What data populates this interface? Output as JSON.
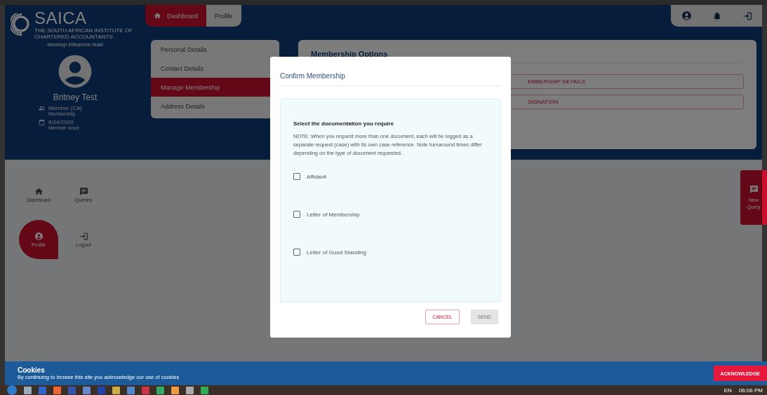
{
  "logo": {
    "name": "SAICA",
    "tagline": "THE SOUTH AFRICAN INSTITUTE OF CHARTERED ACCOUNTANTS",
    "motto": "develop.influence.lead"
  },
  "profile": {
    "name": "Britney Test",
    "details": [
      {
        "kind": "members",
        "value": "Member (CA)",
        "label": "Membership"
      },
      {
        "kind": "date",
        "value": "6/24/2020",
        "label": "Member since"
      }
    ]
  },
  "top_tabs": [
    {
      "kind": "home",
      "label": "Dashboard",
      "selected": true
    },
    {
      "kind": "plain",
      "label": "Profile",
      "selected": false
    }
  ],
  "top_icons": [
    {
      "kind": "account"
    },
    {
      "kind": "bell"
    },
    {
      "kind": "exit"
    }
  ],
  "profile_menu": [
    {
      "label": "Personal Details",
      "selected": false
    },
    {
      "label": "Contact Details",
      "selected": false
    },
    {
      "label": "Manage Membership",
      "selected": true
    },
    {
      "label": "Address Details",
      "selected": false
    }
  ],
  "membership_options": {
    "title": "Membership Options",
    "actions": [
      "EMBERSHIP DETAILS",
      "SIGNATION"
    ]
  },
  "side_nav": [
    {
      "kind": "home",
      "label": "Dashboard",
      "selected": false
    },
    {
      "kind": "queries",
      "label": "Queries",
      "selected": false
    },
    {
      "kind": "profile",
      "label": "Profile",
      "selected": true
    },
    {
      "kind": "exit",
      "label": "Logout",
      "selected": false
    }
  ],
  "new_query": {
    "label": "New Query"
  },
  "dialog": {
    "title": "Confirm Membership",
    "heading": "Select the documentation you require",
    "note": "NOTE: When you request more than one document, each will be logged as a separate request (case) with its own case reference. Note turnaround times differ depending on the type of document requested.",
    "options": [
      {
        "label": "Affidavit",
        "checked": false
      },
      {
        "label": "Letter of Membership",
        "checked": false
      },
      {
        "label": "Letter of Good Standing",
        "checked": false
      }
    ],
    "buttons": [
      {
        "kind": "cancel",
        "label": "CANCEL",
        "disabled": false
      },
      {
        "kind": "send",
        "label": "SEND",
        "disabled": true
      }
    ]
  },
  "cookie_bar": {
    "title": "Cookies",
    "text": "By continuing to browse this site you acknowledge our use of cookies",
    "button": "ACKNOWLEDGE"
  },
  "taskbar": {
    "language": "EN",
    "time": "06:06 PM"
  }
}
